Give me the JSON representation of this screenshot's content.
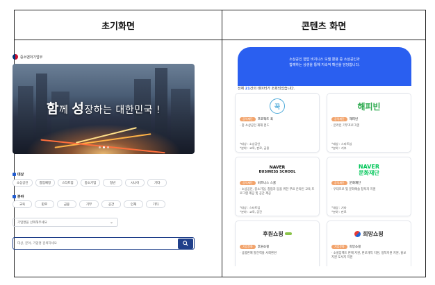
{
  "table": {
    "left_header": "초기화면",
    "right_header": "콘텐츠 화면"
  },
  "initial": {
    "ministry": "중소벤처기업부",
    "hero_slogan": {
      "p1": "함",
      "p2": "께 ",
      "p3": "성",
      "p4": "장하는 대한민국 !"
    },
    "target_label": "대상",
    "targets": [
      "소상공인",
      "창업예정",
      "스타트업",
      "중소기업",
      "청년",
      "시니어",
      "기타"
    ],
    "field_label": "분야",
    "fields": [
      "교육",
      "판로",
      "금융",
      "기부",
      "공간",
      "인재",
      "기타"
    ],
    "select_placeholder": "기업명을 선택해주세요",
    "search_placeholder": "대상, 분야, 기업명 검색하세요"
  },
  "content": {
    "banner_line1": "소상공인 협업 비지니스 모델 활용 중 소상공인과",
    "banner_line2": "함께하는 상생을 통해 지속적 확산을 담당합니다.",
    "count_prefix": "전체 ",
    "count_num": "21",
    "count_suffix": "건의 데이터가 조회되었습니다.",
    "cards": [
      {
        "logo": "꾹",
        "tag": "공익재단",
        "name": "프로젝트 꾹",
        "desc": "· 중 소상공인 재해 펀드",
        "target": "*대상 : 소상공인",
        "field": "*분야 : 교육, 판로, 금융"
      },
      {
        "logo": "해피빈",
        "tag": "공익재단",
        "name": "해피빈",
        "desc": "· 온라인 기부프로그램",
        "target": "*대상 : 스타트업",
        "field": "*분야 : 기부"
      },
      {
        "logo_line1": "NAVER",
        "logo_line2": "BUSINESS SCHOOL",
        "tag": "공익재단",
        "name": "비즈니스 스쿨",
        "desc": "· 소상공인, 중소기업, 창업자 등을 위한 무료 온라인 교육 프로그램 제공 및 공간 제공",
        "target": "*대상 : 스타트업",
        "field": "*분야 : 교육, 공간"
      },
      {
        "logo_line1": "NAVER",
        "logo_line2": "문화재단",
        "tag": "공익재단",
        "name": "문화재단",
        "desc": "· 우대프로 및 문화예술 창작자 지원",
        "target": "*대상 : 기타",
        "field": "*분야 : 판로"
      },
      {
        "logo": "후원쇼핑",
        "tag": "기업문화",
        "name": "후원쇼핑",
        "desc": "· 상품판매 발전력을 사회환원"
      },
      {
        "logo": "희망쇼핑",
        "tag": "기업문화",
        "name": "희망쇼핑",
        "desc": "· 소셜임팩트 판매 지원, 판로개척 지원, 정착지원 지원, 홍보지원 도서지 지원"
      }
    ]
  },
  "colors": {
    "accent": "#2563eb",
    "tag": "#f2a36b",
    "search_border": "#1f3f8a"
  }
}
